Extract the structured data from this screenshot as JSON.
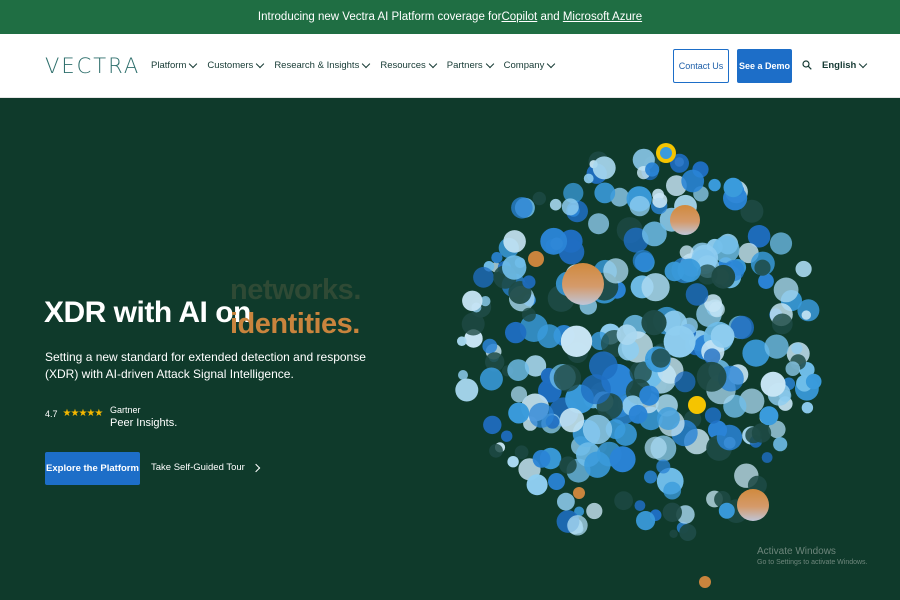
{
  "banner": {
    "prefix": "Introducing new Vectra AI Platform coverage for ",
    "link1": "Copilot",
    "and": " and ",
    "link2": "Microsoft Azure"
  },
  "header": {
    "logo": "VECTRA",
    "nav": [
      "Platform",
      "Customers",
      "Research & Insights",
      "Resources",
      "Partners",
      "Company"
    ],
    "contact": "Contact Us",
    "demo": "See a Demo",
    "language": "English"
  },
  "hero": {
    "headline": "XDR with AI on",
    "word_faded": "networks.",
    "word_active": "identities.",
    "subtitle": "Setting a new standard for extended detection and response (XDR) with AI-driven Attack Signal Intelligence.",
    "rating": "4.7",
    "stars": "★★★★★",
    "gartner1": "Gartner",
    "gartner2": "Peer Insights.",
    "explore": "Explore the Platform",
    "tour": "Take Self-Guided Tour"
  },
  "watermark": {
    "title": "Activate Windows",
    "sub": "Go to Settings to activate Windows."
  },
  "colors": {
    "banner": "#1f6e43",
    "hero_bg": "#0f3a2b",
    "accent_blue": "#1d6ec8",
    "orange": "#c9843d",
    "yellow": "#f5c400"
  }
}
